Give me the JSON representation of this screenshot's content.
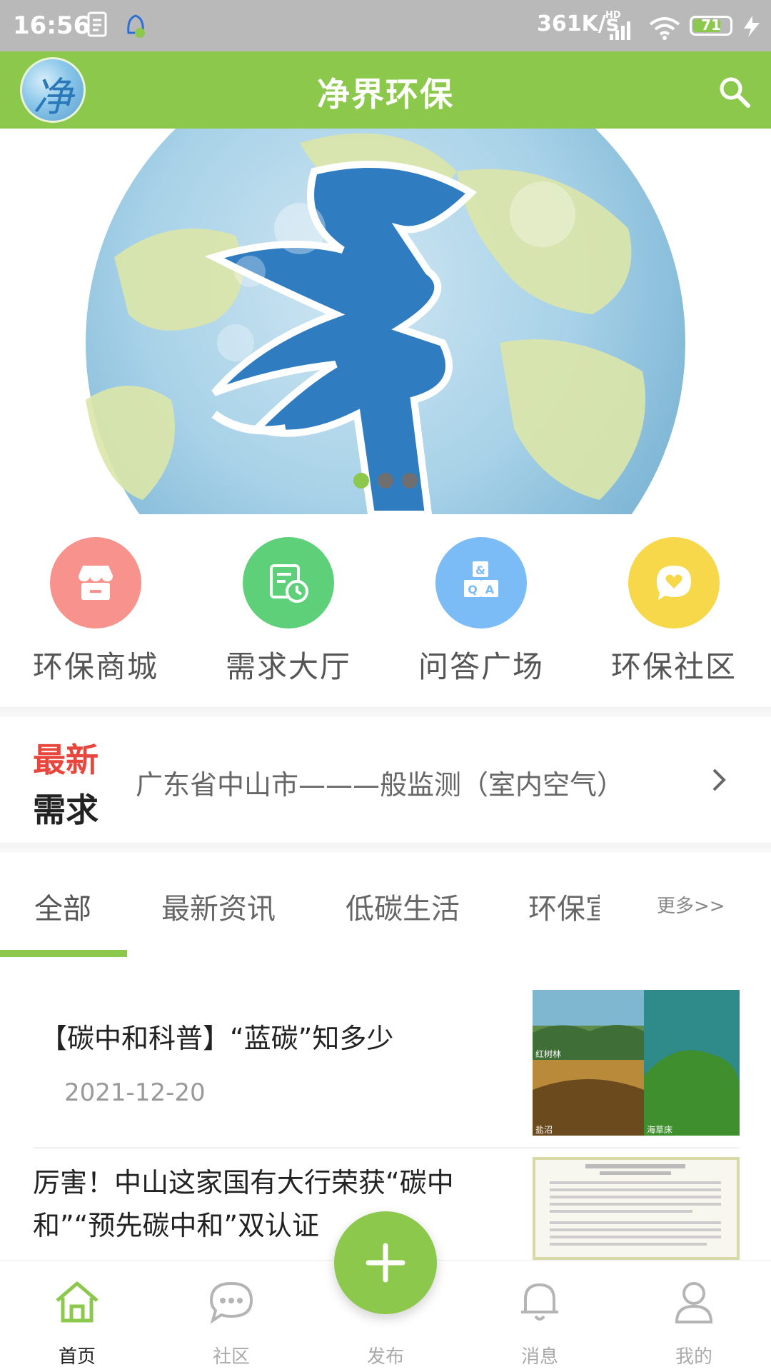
{
  "status_bar": {
    "time": "16:56",
    "net_speed": "361K/s",
    "hd": "HD",
    "battery": "71"
  },
  "header": {
    "title": "净界环保",
    "logo_char": "净"
  },
  "banner": {
    "slide_count": 3,
    "active_slide": 1
  },
  "quick_actions": [
    {
      "label": "环保商城",
      "icon": "store-icon",
      "color": "#f7928c"
    },
    {
      "label": "需求大厅",
      "icon": "schedule-icon",
      "color": "#5fd07a"
    },
    {
      "label": "问答广场",
      "icon": "qa-blocks-icon",
      "color": "#7bbcf7"
    },
    {
      "label": "环保社区",
      "icon": "chat-heart-icon",
      "color": "#f7d84a"
    }
  ],
  "news_ticker": {
    "tag_line1": "最新",
    "tag_line2": "需求",
    "text": "广东省中山市———般监测（室内空气）"
  },
  "category_tabs": {
    "items": [
      "全部",
      "最新资讯",
      "低碳生活",
      "环保宣"
    ],
    "more": "更多>>",
    "active": 0
  },
  "articles": [
    {
      "title": "【碳中和科普】“蓝碳”知多少",
      "date": "2021-12-20",
      "thumb_labels": [
        "红树林",
        "盐沼",
        "海草床"
      ]
    },
    {
      "title_line1": "厉害！中山这家国有大行荣获“碳中",
      "title_line2": "和”“预先碳中和”双认证"
    }
  ],
  "bottom_nav": {
    "items": [
      {
        "label": "首页",
        "icon": "home-icon"
      },
      {
        "label": "社区",
        "icon": "community-icon"
      },
      {
        "label": "发布",
        "icon": "publish-icon"
      },
      {
        "label": "消息",
        "icon": "bell-icon"
      },
      {
        "label": "我的",
        "icon": "profile-icon"
      }
    ],
    "active": 0
  },
  "colors": {
    "brand_green": "#8cc84b",
    "accent_red": "#e8453c"
  }
}
